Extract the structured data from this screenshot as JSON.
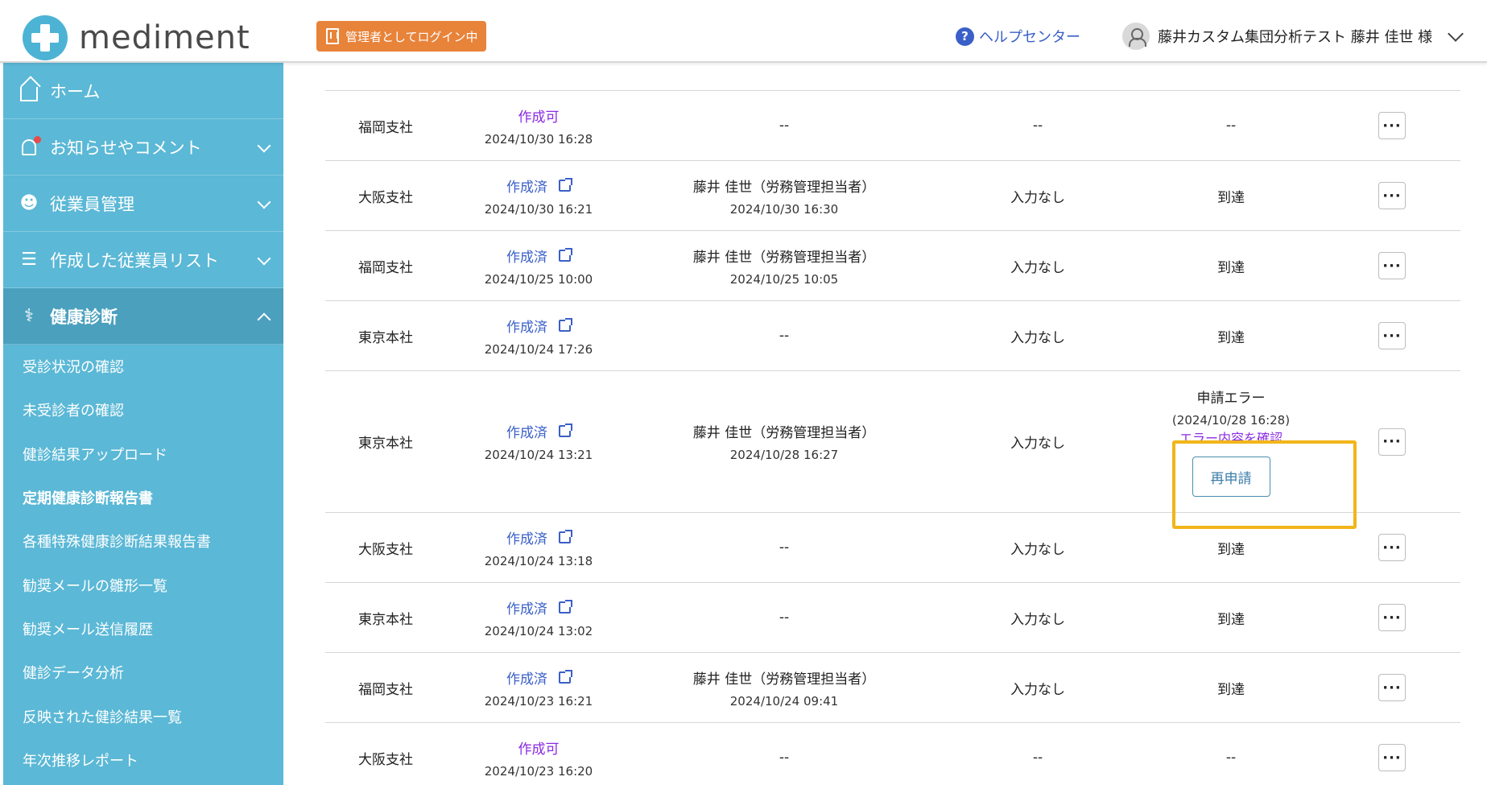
{
  "header": {
    "logo_text": "mediment",
    "admin_badge": "管理者としてログイン中",
    "help_label": "ヘルプセンター",
    "user_label": "藤井カスタム集団分析テスト 藤井 佳世 様"
  },
  "sidebar": {
    "items": [
      {
        "label": "ホーム"
      },
      {
        "label": "お知らせやコメント"
      },
      {
        "label": "従業員管理"
      },
      {
        "label": "作成した従業員リスト"
      },
      {
        "label": "健康診断"
      }
    ],
    "sub_items": [
      "受診状況の確認",
      "未受診者の確認",
      "健診結果アップロード",
      "定期健康診断報告書",
      "各種特殊健康診断結果報告書",
      "勧奨メールの雛形一覧",
      "勧奨メール送信履歴",
      "健診データ分析",
      "反映された健診結果一覧",
      "年次推移レポート"
    ]
  },
  "table": {
    "rows": [
      {
        "branch": "福岡支社",
        "create_label": "作成可",
        "create_date": "2024/10/30 16:28",
        "person": "--",
        "person_date": "",
        "input": "--",
        "status": "--"
      },
      {
        "branch": "大阪支社",
        "create_label": "作成済",
        "create_date": "2024/10/30 16:21",
        "person": "藤井 佳世（労務管理担当者）",
        "person_date": "2024/10/30 16:30",
        "input": "入力なし",
        "status": "到達"
      },
      {
        "branch": "福岡支社",
        "create_label": "作成済",
        "create_date": "2024/10/25 10:00",
        "person": "藤井 佳世（労務管理担当者）",
        "person_date": "2024/10/25 10:05",
        "input": "入力なし",
        "status": "到達"
      },
      {
        "branch": "東京本社",
        "create_label": "作成済",
        "create_date": "2024/10/24 17:26",
        "person": "--",
        "person_date": "",
        "input": "入力なし",
        "status": "到達"
      },
      {
        "branch": "東京本社",
        "create_label": "作成済",
        "create_date": "2024/10/24 13:21",
        "person": "藤井 佳世（労務管理担当者）",
        "person_date": "2024/10/28 16:27",
        "input": "入力なし",
        "status": "申請エラー",
        "error_date": "(2024/10/28 16:28)",
        "error_link": "エラー内容を確認",
        "reapply": "再申請"
      },
      {
        "branch": "大阪支社",
        "create_label": "作成済",
        "create_date": "2024/10/24 13:18",
        "person": "--",
        "person_date": "",
        "input": "入力なし",
        "status": "到達"
      },
      {
        "branch": "東京本社",
        "create_label": "作成済",
        "create_date": "2024/10/24 13:02",
        "person": "--",
        "person_date": "",
        "input": "入力なし",
        "status": "到達"
      },
      {
        "branch": "福岡支社",
        "create_label": "作成済",
        "create_date": "2024/10/23 16:21",
        "person": "藤井 佳世（労務管理担当者）",
        "person_date": "2024/10/24 09:41",
        "input": "入力なし",
        "status": "到達"
      },
      {
        "branch": "大阪支社",
        "create_label": "作成可",
        "create_date": "2024/10/23 16:20",
        "person": "--",
        "person_date": "",
        "input": "--",
        "status": "--"
      }
    ],
    "more_label": "···"
  },
  "colors": {
    "sidebar": "#5bb8d6",
    "sidebar_active": "#4aa0bd",
    "admin_badge": "#e8833a",
    "highlight": "#f2b51a",
    "link_blue": "#3a5fc8",
    "link_purple": "#8a2be2"
  }
}
